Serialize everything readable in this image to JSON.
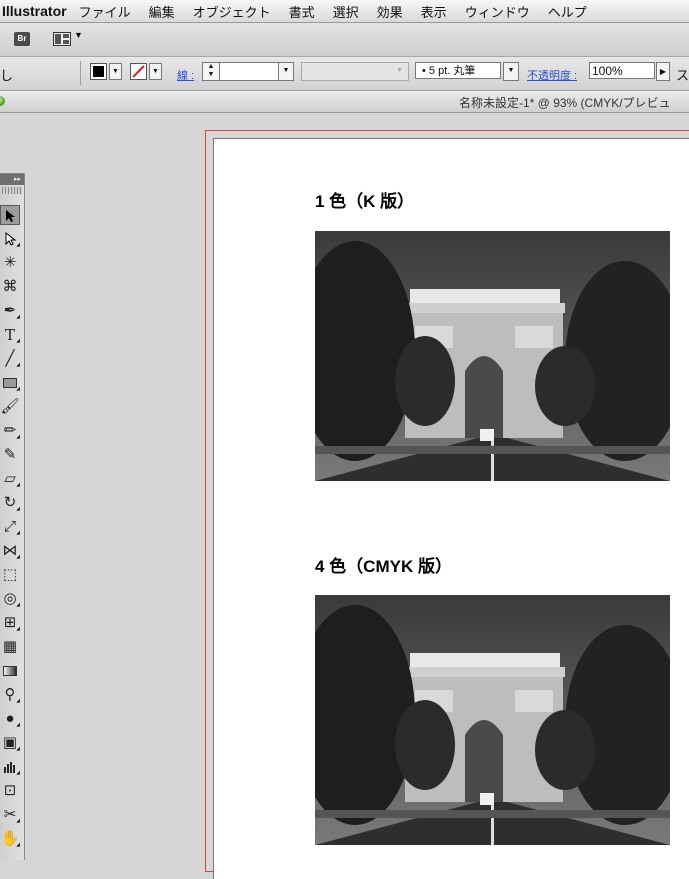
{
  "menubar": {
    "app_name": "Illustrator",
    "items": [
      "ファイル",
      "編集",
      "オブジェクト",
      "書式",
      "選択",
      "効果",
      "表示",
      "ウィンドウ",
      "ヘルプ"
    ]
  },
  "appbar": {
    "bridge_label": "Br"
  },
  "controlbar": {
    "left_text": "し",
    "stroke_label": "線 :",
    "brush_value": "• 5 pt. 丸筆",
    "opacity_label": "不透明度 :",
    "opacity_value": "100%",
    "style_label": "ス"
  },
  "doctab": {
    "title": "名称未設定-1* @ 93% (CMYK/プレビュ"
  },
  "document": {
    "heading1": "1 色（K 版）",
    "heading2": "4 色（CMYK 版）"
  },
  "toolbox": {
    "collapse_glyph": "▸▸"
  },
  "colors": {
    "artboard_border": "#d9443c",
    "stroke_swatch_slash": "#e02020",
    "link_blue": "#2a4fd1"
  }
}
